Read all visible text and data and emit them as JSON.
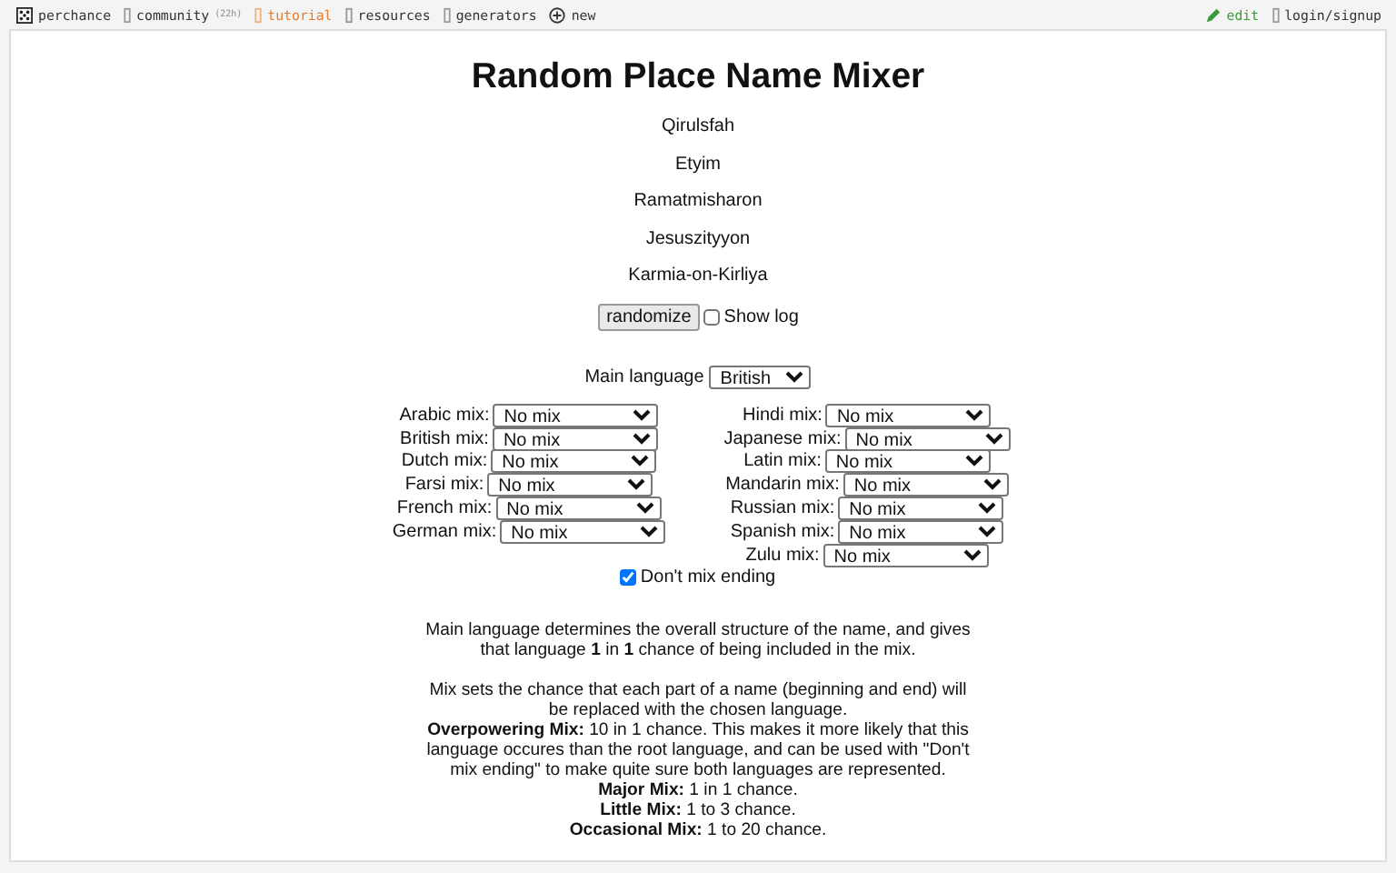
{
  "topbar": {
    "left": [
      {
        "kind": "dice",
        "label": "perchance",
        "selected": false
      },
      {
        "kind": "box",
        "label": "community",
        "badge": "(22h)",
        "selected": false
      },
      {
        "kind": "box",
        "label": "tutorial",
        "selected": true
      },
      {
        "kind": "box",
        "label": "resources",
        "selected": false
      },
      {
        "kind": "box",
        "label": "generators",
        "selected": false
      },
      {
        "kind": "plus",
        "label": "new",
        "selected": false
      }
    ],
    "right": [
      {
        "kind": "pencil",
        "label": "edit"
      },
      {
        "kind": "box",
        "label": "login/signup"
      }
    ]
  },
  "title": "Random Place Name Mixer",
  "names": [
    "Qirulsfah",
    "Etyim",
    "Ramatmisharon",
    "Jesuszityyon",
    "Karmia-on-Kirliya"
  ],
  "randomize_button": "randomize",
  "show_log": {
    "label": "Show log",
    "checked": false
  },
  "main_language": {
    "label": "Main language",
    "value": "British"
  },
  "mix_columns": [
    [
      {
        "label": "Arabic mix:",
        "value": "No mix"
      },
      {
        "label": "British mix:",
        "value": "No mix"
      },
      {
        "label": "Dutch mix:",
        "value": "No mix"
      },
      {
        "label": "Farsi mix:",
        "value": "No mix"
      },
      {
        "label": "French mix:",
        "value": "No mix"
      },
      {
        "label": "German mix:",
        "value": "No mix"
      }
    ],
    [
      {
        "label": "Hindi mix:",
        "value": "No mix"
      },
      {
        "label": "Japanese mix:",
        "value": "No mix"
      },
      {
        "label": "Latin mix:",
        "value": "No mix"
      },
      {
        "label": "Mandarin mix:",
        "value": "No mix"
      },
      {
        "label": "Russian mix:",
        "value": "No mix"
      },
      {
        "label": "Spanish mix:",
        "value": "No mix"
      },
      {
        "label": "Zulu mix:",
        "value": "No mix"
      }
    ]
  ],
  "dont_mix_ending": {
    "label": "Don't mix ending",
    "checked": true
  },
  "description": [
    [
      "Main language determines the overall structure of the name, and gives that language **1** in **1** chance of being included in the mix."
    ],
    [
      "Mix sets the chance that each part of a name (beginning and end) will be replaced with the chosen language.",
      "**Overpowering Mix:** 10 in 1 chance. This makes it more likely that this language occures than the root language, and can be used with \"Don't mix ending\" to make quite sure both languages are represented.",
      "**Major Mix:** 1 in 1 chance.",
      "**Little Mix:** 1 to 3 chance.",
      "**Occasional Mix:** 1 to 20 chance."
    ]
  ]
}
